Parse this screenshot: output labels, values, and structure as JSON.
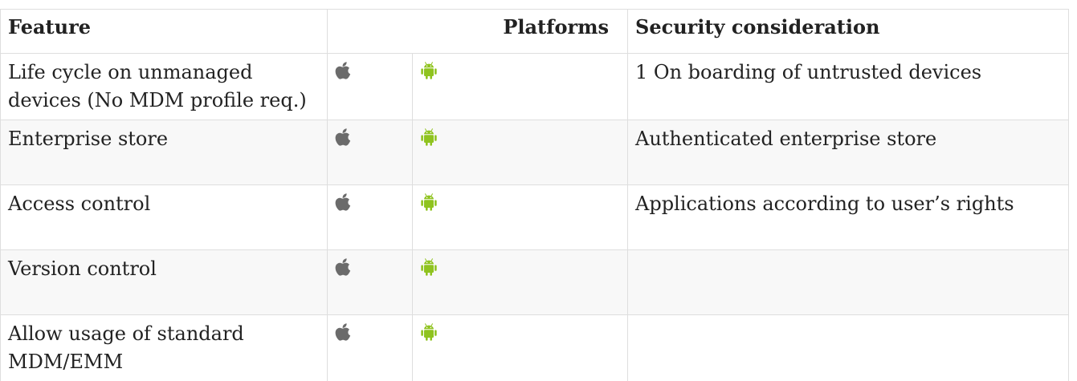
{
  "table": {
    "headers": {
      "feature": "Feature",
      "platforms": "Platforms",
      "security": "Security consideration"
    },
    "rows": [
      {
        "feature": "Life cycle on unmanaged devices (No MDM profile req.)",
        "ios_icon": "apple-icon",
        "android_icon": "android-icon",
        "security": "1 On boarding of untrusted devices"
      },
      {
        "feature": "Enterprise store",
        "ios_icon": "apple-icon",
        "android_icon": "android-icon",
        "security": "Authenticated enterprise store"
      },
      {
        "feature": "Access control",
        "ios_icon": "apple-icon",
        "android_icon": "android-icon",
        "security": "Applications according to user’s rights"
      },
      {
        "feature": "Version control",
        "ios_icon": "apple-icon",
        "android_icon": "android-icon",
        "security": ""
      },
      {
        "feature": "Allow usage of standard MDM/EMM",
        "ios_icon": "apple-icon",
        "android_icon": "android-icon",
        "security": ""
      }
    ]
  },
  "colors": {
    "apple_icon": "#6b6b6b",
    "android_icon": "#8fc31f",
    "border": "#dedede",
    "stripe": "#f8f8f8"
  }
}
